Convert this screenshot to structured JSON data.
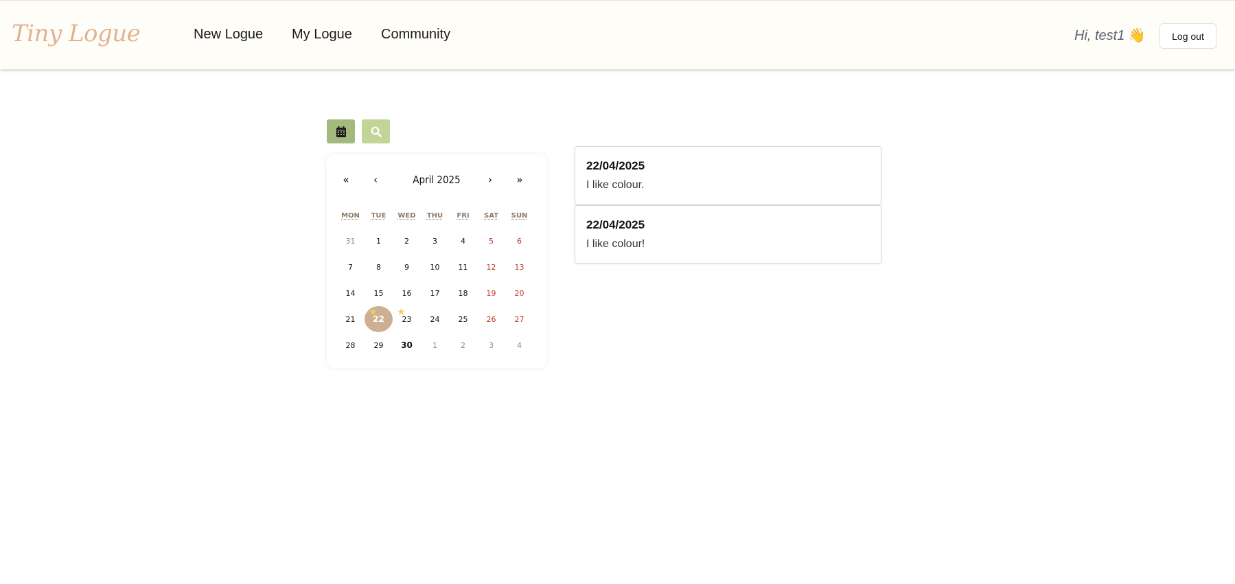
{
  "header": {
    "logo": "Tiny Logue",
    "nav": [
      "New Logue",
      "My Logue",
      "Community"
    ],
    "greeting": "Hi, test1",
    "greeting_emoji": "👋",
    "logout_label": "Log out"
  },
  "toolbar": {
    "calendar_icon": "calendar-icon",
    "search_icon": "search-icon"
  },
  "calendar": {
    "prev_year": "«",
    "prev_month": "‹",
    "title": "April 2025",
    "next_month": "›",
    "next_year": "»",
    "weekdays": [
      "MON",
      "TUE",
      "WED",
      "THU",
      "FRI",
      "SAT",
      "SUN"
    ],
    "weeks": [
      [
        "31",
        "1",
        "2",
        "3",
        "4",
        "5",
        "6"
      ],
      [
        "7",
        "8",
        "9",
        "10",
        "11",
        "12",
        "13"
      ],
      [
        "14",
        "15",
        "16",
        "17",
        "18",
        "19",
        "20"
      ],
      [
        "21",
        "22",
        "23",
        "24",
        "25",
        "26",
        "27"
      ],
      [
        "28",
        "29",
        "30",
        "1",
        "2",
        "3",
        "4"
      ]
    ],
    "selected_day": "22",
    "today": "30",
    "starred_days": [
      "22",
      "23"
    ],
    "colors": {
      "selected_bg": "#cdb093",
      "weekend": "#c0392b",
      "star": "#f2cf5a"
    }
  },
  "entries": [
    {
      "date": "22/04/2025",
      "text": "I like colour."
    },
    {
      "date": "22/04/2025",
      "text": "I like colour!"
    }
  ],
  "colors": {
    "logo": "#e2b291",
    "header_bg": "#fffdf8",
    "calendar_button": "#a3b97e",
    "search_button": "#c1d597"
  }
}
